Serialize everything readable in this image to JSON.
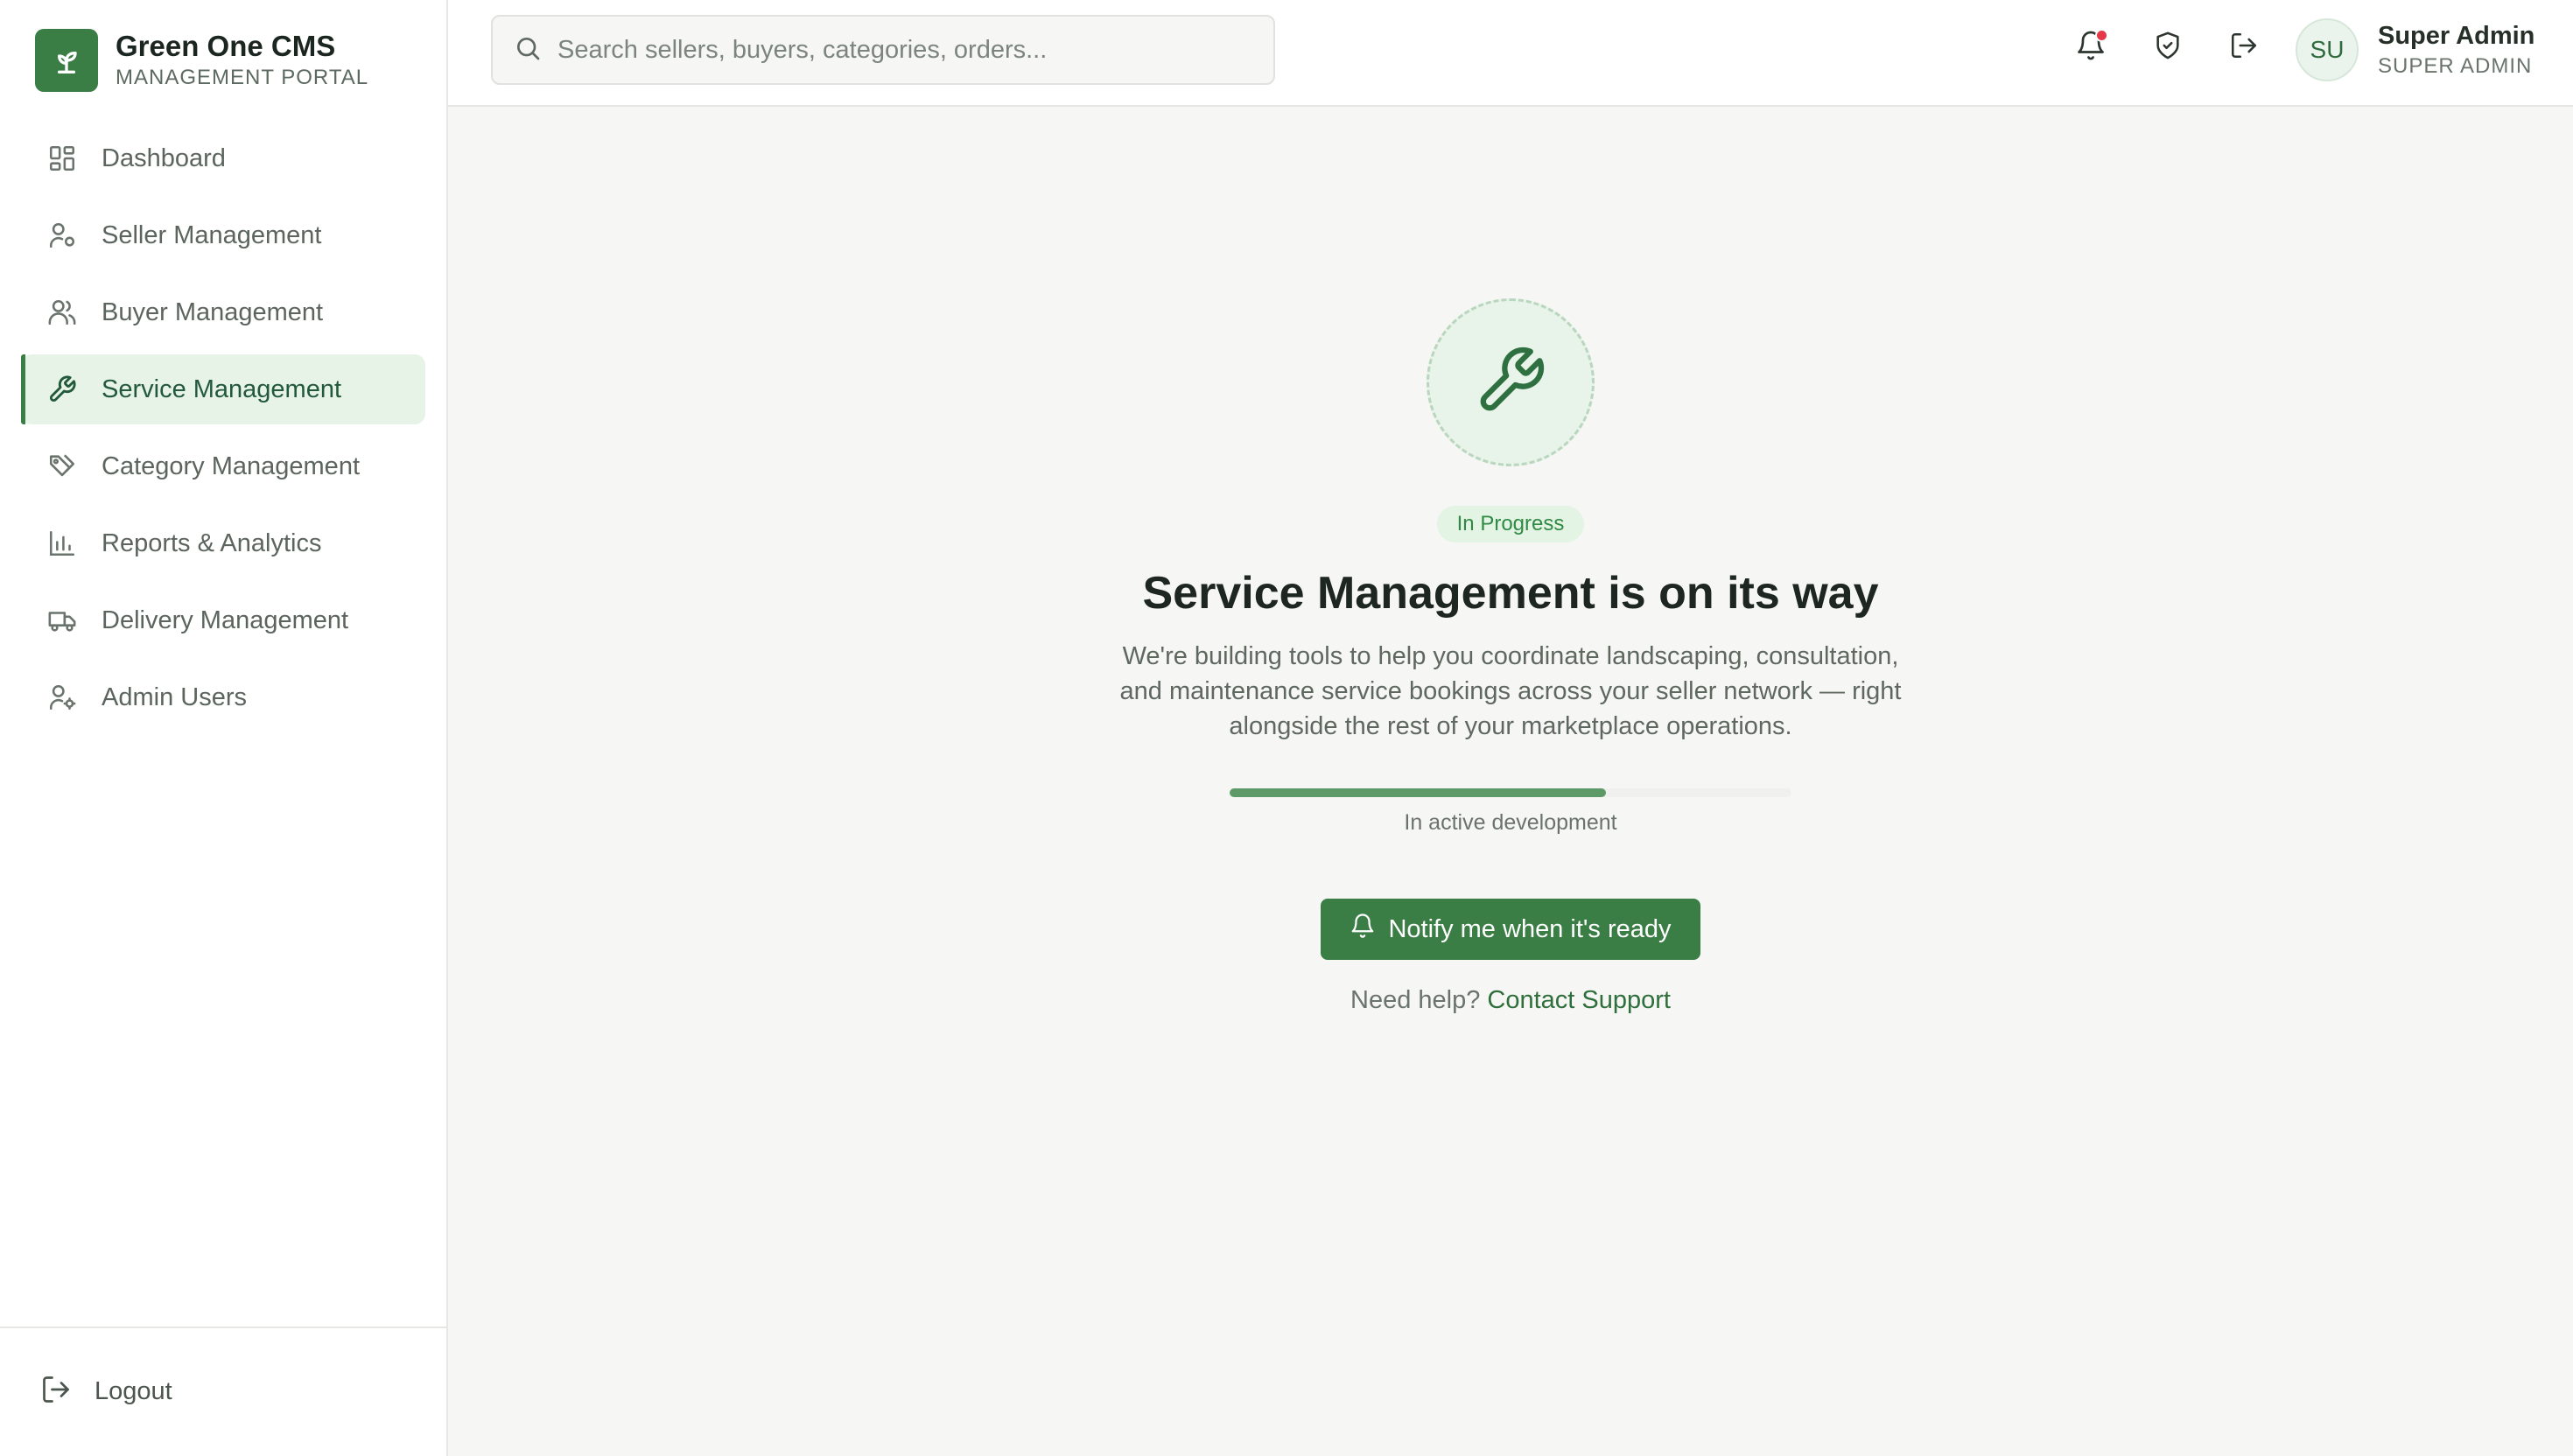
{
  "brand": {
    "title": "Green One CMS",
    "subtitle": "MANAGEMENT PORTAL",
    "logo_icon": "sprout-icon"
  },
  "sidebar": {
    "items": [
      {
        "label": "Dashboard",
        "icon": "dashboard-icon",
        "active": false
      },
      {
        "label": "Seller Management",
        "icon": "user-gear-icon",
        "active": false
      },
      {
        "label": "Buyer Management",
        "icon": "users-icon",
        "active": false
      },
      {
        "label": "Service Management",
        "icon": "wrench-icon",
        "active": true
      },
      {
        "label": "Category Management",
        "icon": "tags-icon",
        "active": false
      },
      {
        "label": "Reports & Analytics",
        "icon": "bar-chart-icon",
        "active": false
      },
      {
        "label": "Delivery Management",
        "icon": "truck-icon",
        "active": false
      },
      {
        "label": "Admin Users",
        "icon": "user-cog-icon",
        "active": false
      }
    ],
    "logout_label": "Logout"
  },
  "header": {
    "search_placeholder": "Search sellers, buyers, categories, orders...",
    "user": {
      "initials": "SU",
      "name": "Super Admin",
      "role": "SUPER ADMIN"
    },
    "notifications_unread": true
  },
  "main": {
    "status": "In Progress",
    "title": "Service Management is on its way",
    "description": "We're building tools to help you coordinate landscaping, consultation, and maintenance service bookings across your seller network — right alongside the rest of your marketplace operations.",
    "progress": 0.67,
    "progress_label": "In active development",
    "notify_label": "Notify me when it's ready",
    "help_text": "Need help?",
    "help_link": "Contact Support"
  },
  "colors": {
    "accent": "#3a7d45",
    "accent_light": "#e7f3e7",
    "badge_text": "#2f8a44",
    "alert": "#e5394a"
  }
}
